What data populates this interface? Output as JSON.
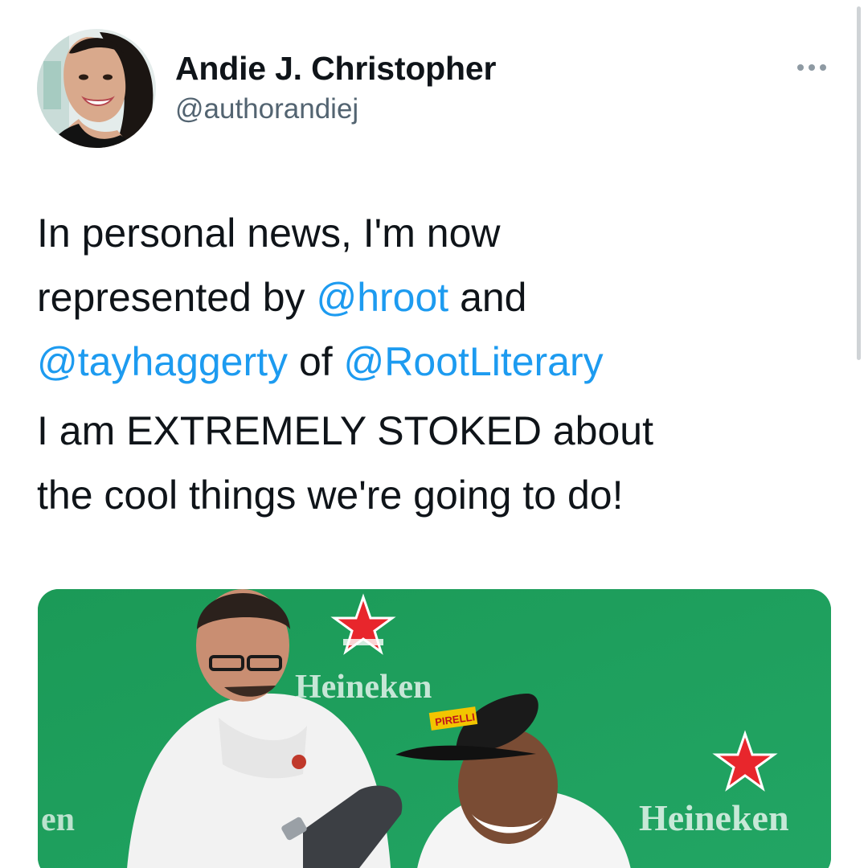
{
  "author": {
    "display_name": "Andie J. Christopher",
    "handle": "@authorandiej"
  },
  "tweet": {
    "line1": "In personal news, I'm now",
    "line2_prefix": "represented by ",
    "mention_1": "@hroot",
    "line2_suffix": " and",
    "mention_2": "@tayhaggerty",
    "line3_middle": " of ",
    "mention_3": "@RootLiterary",
    "line4": "I am EXTREMELY STOKED about",
    "line5": "the cool things we're going to do!"
  },
  "media": {
    "sign_text_top": "Heineken",
    "sign_text_left": "en",
    "sign_text_right": "Heineken",
    "cap_brand": "PIRELLI"
  },
  "icons": {
    "more": "ellipsis-horizontal-icon"
  },
  "colors": {
    "link": "#1d9bf0",
    "text": "#0f1419",
    "secondary": "#536471",
    "media_green": "#1e9b5a"
  }
}
